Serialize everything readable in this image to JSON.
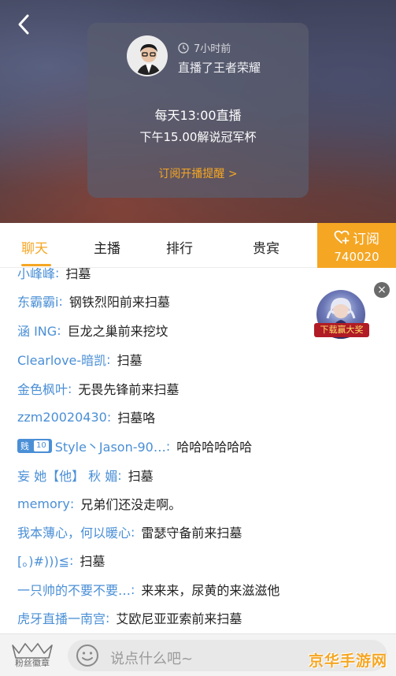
{
  "header": {
    "back_icon": "chevron-left-icon",
    "card": {
      "time_ago": "7小时前",
      "played_game": "直播了王者荣耀",
      "schedule_line1": "每天13:00直播",
      "schedule_line2": "下午15.00解说冠军杯",
      "subscribe_remind": "订阅开播提醒 >"
    }
  },
  "tabs": [
    {
      "label": "聊天",
      "active": true
    },
    {
      "label": "主播"
    },
    {
      "label": "排行"
    },
    {
      "label": "贵宾"
    }
  ],
  "subscribe": {
    "label": "订阅",
    "count": "740020"
  },
  "chat": [
    {
      "user": "小峰峰",
      "text": "扫墓"
    },
    {
      "user": "东霸霸i",
      "text": "钢铁烈阳前来扫墓"
    },
    {
      "user": "涵 ING",
      "text": "巨龙之巢前来挖坟"
    },
    {
      "user": "Clearlove-暗凯",
      "text": "扫墓"
    },
    {
      "user": "金色枫叶",
      "text": "无畏先锋前来扫墓"
    },
    {
      "user": "zzm20020430",
      "text": "扫墓咯"
    },
    {
      "user": "Style丶Jason-90…",
      "text": "哈哈哈哈哈哈",
      "badge": "贱",
      "badge_level": "10"
    },
    {
      "user": "妄 她【他】 秋 媚",
      "text": "扫墓"
    },
    {
      "user": "memory",
      "text": "兄弟们还没走啊。"
    },
    {
      "user": "我本薄心，何以暖心",
      "text": "雷瑟守备前来扫墓"
    },
    {
      "user": "[。)#)))≦",
      "text": "扫墓"
    },
    {
      "user": "一只帅的不要不要…",
      "text": "来来来，尿黄的来滋滋他"
    },
    {
      "user": "虎牙直播一南宫",
      "text": "艾欧尼亚亚索前来扫墓"
    }
  ],
  "ad": {
    "label": "下载赢大奖",
    "close": "×"
  },
  "bottom": {
    "fan_badge_label": "粉丝徽章",
    "input_placeholder": "说点什么吧~",
    "watermark": "京华手游网"
  },
  "colors": {
    "accent": "#f5a623",
    "username": "#4a8fd6"
  }
}
